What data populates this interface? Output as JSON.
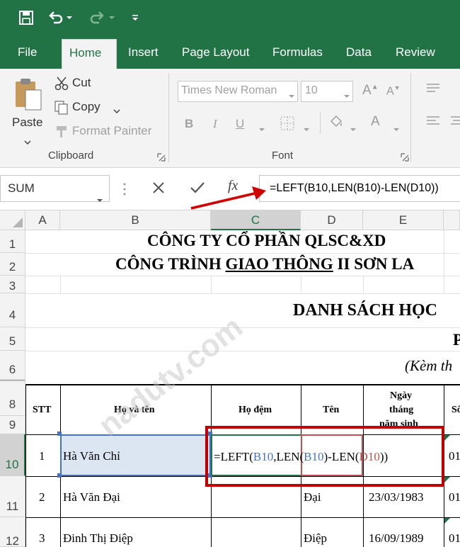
{
  "ribbon_tabs": [
    "File",
    "Home",
    "Insert",
    "Page Layout",
    "Formulas",
    "Data",
    "Review"
  ],
  "clipboard": {
    "paste": "Paste",
    "cut": "Cut",
    "copy": "Copy",
    "format_painter": "Format Painter",
    "group_label": "Clipboard"
  },
  "font": {
    "name": "Times New Roman",
    "size": "10",
    "group_label": "Font",
    "bold": "B",
    "italic": "I",
    "underline": "U"
  },
  "name_box": "SUM",
  "formula": "=LEFT(B10,LEN(B10)-LEN(D10))",
  "fx_label": "fx",
  "columns": [
    "A",
    "B",
    "C",
    "D",
    "E"
  ],
  "rows": [
    "1",
    "2",
    "3",
    "4",
    "5",
    "6",
    "8",
    "9",
    "10",
    "11",
    "12"
  ],
  "sheet": {
    "title1": "CÔNG TY CỔ PHẦN QLSC&XD",
    "title2_pre": "CÔNG TRÌNH ",
    "title2_ul": "GIAO THÔNG",
    "title2_post": " II SƠN LA",
    "title3": "DANH SÁCH HỌC",
    "row5_fragment": "P",
    "row6_fragment": "(Kèm th",
    "headers": {
      "stt": "STT",
      "name": "Họ và tên",
      "middle": "Họ đệm",
      "first": "Tên",
      "dob_l1": "Ngày",
      "dob_l2": "tháng",
      "dob_l3": "năm sinh",
      "f_col": "Số"
    },
    "data_rows": [
      {
        "stt": "1",
        "name": "Hà Văn Chỉ",
        "first": "",
        "dob": "",
        "f": "01"
      },
      {
        "stt": "2",
        "name": "Hà Văn Đại",
        "first": "Đại",
        "dob": "23/03/1983",
        "f": "01"
      },
      {
        "stt": "3",
        "name": "Đinh Thị Điệp",
        "first": "Điệp",
        "dob": "16/09/1989",
        "f": "01"
      }
    ],
    "edit_formula": {
      "p1": "=LEFT(",
      "ref1": "B10",
      "p2": ",LEN(",
      "ref2": "B10",
      "p3": ")-LEN(",
      "ref3": "D10",
      "p4": "))"
    },
    "watermark": "nadutv.com"
  },
  "colors": {
    "excel_green": "#217346",
    "ref_blue": "#4472c4",
    "ref_red": "#c0504d",
    "highlight_box": "#c00000"
  }
}
